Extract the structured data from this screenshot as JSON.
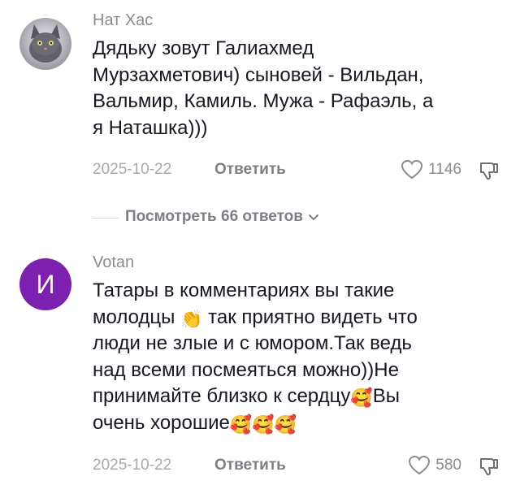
{
  "comments": [
    {
      "username": "Нат Хас",
      "text_lines": [
        "Дядьку зовут Галиахмед",
        "Мурзахметович) сыновей - Вильдан,",
        "Вальмир, Камиль. Мужа - Рафаэль, а",
        "я Наташка)))"
      ],
      "date": "2025-10-22",
      "reply_label": "Ответить",
      "likes": "1146",
      "view_replies": "Посмотреть 66 ответов"
    },
    {
      "username": "Votan",
      "avatar_letter": "И",
      "text_lines": [
        "Татары в комментариях вы такие",
        "молодцы",
        "так приятно видеть что",
        "люди не злые и с юмором.Так ведь",
        "над всеми посмеяться можно))Не",
        "принимайте близко к сердцу",
        "Вы",
        "очень хорошие"
      ],
      "emoji_clap": "👏",
      "emoji_love": "🥰",
      "date": "2025-10-22",
      "reply_label": "Ответить",
      "likes": "580"
    }
  ],
  "colors": {
    "avatar_purple": "#7d1fb0",
    "muted_text": "#8a8b91",
    "primary_text": "#161823"
  },
  "icons": [
    "cat-avatar-image",
    "heart-outline-icon",
    "dislike-thumb-icon",
    "chevron-down-icon"
  ]
}
